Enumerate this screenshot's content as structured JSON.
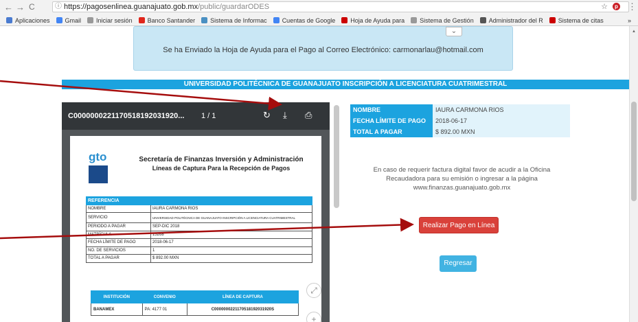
{
  "browser": {
    "url_host": "https://pagosenlinea.guanajuato.gob.mx",
    "url_path": "/public/guardarODES",
    "bookmarks": [
      {
        "label": "Aplicaciones",
        "color": "#4a7bd0"
      },
      {
        "label": "Gmail",
        "color": "#4285f4"
      },
      {
        "label": "Iniciar sesión",
        "color": "#999999"
      },
      {
        "label": "Banco Santander",
        "color": "#e0261b"
      },
      {
        "label": "Sistema de Informac",
        "color": "#4a90c2"
      },
      {
        "label": "Cuentas de Google",
        "color": "#4285f4"
      },
      {
        "label": "Hoja de Ayuda para",
        "color": "#cc0000"
      },
      {
        "label": "Sistema de Gestión",
        "color": "#999999"
      },
      {
        "label": "Administrador del R",
        "color": "#555555"
      },
      {
        "label": "Sistema de citas",
        "color": "#cc0000"
      }
    ],
    "more": "»"
  },
  "notice": {
    "text": "Se ha Enviado la Hoja de Ayuda para el Pago al Correo Electrónico: carmonarlau@hotmail.com"
  },
  "banner": {
    "text": "UNIVERSIDAD POLITÉCNICA DE GUANAJUATO INSCRIPCIÓN A LICENCIATURA CUATRIMESTRAL"
  },
  "pdf": {
    "filename": "C0000000221170518192031920...",
    "page": "1 / 1",
    "logo_text": "gto",
    "title": "Secretaría de Finanzas Inversión y Administración",
    "subtitle": "Líneas de Captura Para la Recepción de Pagos",
    "ref_header": "REFERENCIA",
    "ref_rows": [
      {
        "k": "NOMBRE",
        "v": "IAURA CARMONA RIOS"
      },
      {
        "k": "SERVICIO",
        "v": "UNIVERSIDAD POLITÉCNICA DE GUANAJUATO INSCRIPCIÓN A LICENCIATURA CUATRIMESTRAL"
      },
      {
        "k": "PERIODO A PAGAR",
        "v": "SEP-DIC 2018"
      },
      {
        "k": "MATRÍCULA",
        "v": "15268"
      },
      {
        "k": "FECHA LÍMITE DE PAGO",
        "v": "2018-06-17"
      },
      {
        "k": "NO. DE SERVICIOS",
        "v": "1"
      },
      {
        "k": "TOTAL A PAGAR",
        "v": "$ 892.00 MXN"
      }
    ],
    "inst_headers": [
      "INSTITUCIÓN",
      "CONVENIO",
      "LÍNEA DE CAPTURA"
    ],
    "inst_rows": [
      {
        "inst": "BANAMEX",
        "conv": "PA: 4177 01",
        "linea": "C0000000221170518192031920S"
      }
    ]
  },
  "info": {
    "rows": [
      {
        "k": "NOMBRE",
        "v": "IAURA CARMONA RIOS"
      },
      {
        "k": "FECHA LÍMITE DE PAGO",
        "v": "2018-06-17"
      },
      {
        "k": "TOTAL A PAGAR",
        "v": "$ 892.00 MXN"
      }
    ]
  },
  "factura": {
    "line1": "En caso de requerir factura digital favor de acudir a la Oficina",
    "line2": "Recaudadora para su emisión o ingresar a la página",
    "line3": "www.finanzas.guanajuato.gob.mx"
  },
  "buttons": {
    "pay": "Realizar Pago en Línea",
    "back": "Regresar"
  },
  "colors": {
    "accent": "#1ca3df",
    "pay": "#d9413a",
    "arrow": "#a50d0d"
  }
}
